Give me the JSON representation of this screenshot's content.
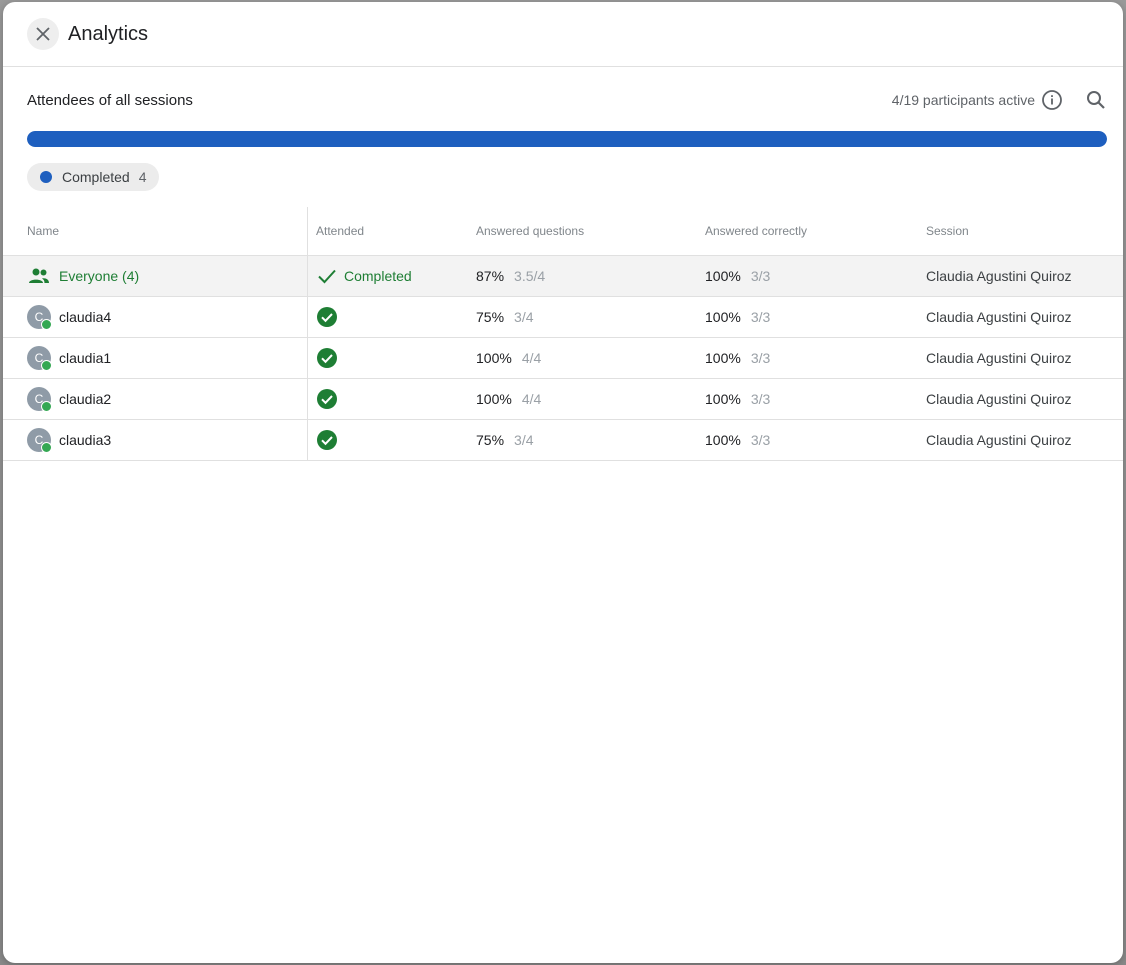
{
  "dialog": {
    "title": "Analytics",
    "close_icon": "close-icon"
  },
  "summary": {
    "section_title": "Attendees of all sessions",
    "active_text": "4/19 participants active",
    "info_icon": "info-icon",
    "search_icon": "search-icon",
    "progress_fraction": 1.0,
    "progress_color": "#1e5fbf"
  },
  "legend_chip": {
    "label": "Completed",
    "count": "4",
    "color": "#1e5fbf"
  },
  "table": {
    "headers": {
      "name": "Name",
      "attended": "Attended",
      "answered": "Answered questions",
      "correct": "Answered correctly",
      "session": "Session"
    },
    "everyone": {
      "icon": "group-icon",
      "name": "Everyone (4)",
      "attended_icon": "check-icon",
      "attended": "Completed",
      "answered_pct": "87%",
      "answered_frac": "3.5/4",
      "correct_pct": "100%",
      "correct_frac": "3/3",
      "session": "Claudia Agustini Quiroz"
    },
    "rows": [
      {
        "initial": "C",
        "name": "claudia4",
        "status_icon": "check-circle-icon",
        "answered_pct": "75%",
        "answered_frac": "3/4",
        "correct_pct": "100%",
        "correct_frac": "3/3",
        "session": "Claudia Agustini Quiroz"
      },
      {
        "initial": "C",
        "name": "claudia1",
        "status_icon": "check-circle-icon",
        "answered_pct": "100%",
        "answered_frac": "4/4",
        "correct_pct": "100%",
        "correct_frac": "3/3",
        "session": "Claudia Agustini Quiroz"
      },
      {
        "initial": "C",
        "name": "claudia2",
        "status_icon": "check-circle-icon",
        "answered_pct": "100%",
        "answered_frac": "4/4",
        "correct_pct": "100%",
        "correct_frac": "3/3",
        "session": "Claudia Agustini Quiroz"
      },
      {
        "initial": "C",
        "name": "claudia3",
        "status_icon": "check-circle-icon",
        "answered_pct": "75%",
        "answered_frac": "3/4",
        "correct_pct": "100%",
        "correct_frac": "3/3",
        "session": "Claudia Agustini Quiroz"
      }
    ]
  },
  "colors": {
    "accent_green": "#1e7e34",
    "online_green": "#34a853"
  }
}
